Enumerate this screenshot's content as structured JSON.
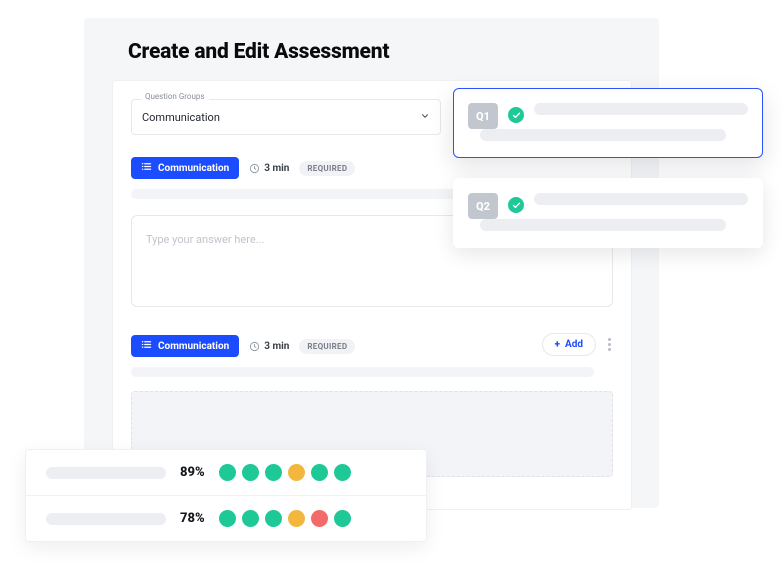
{
  "page": {
    "title": "Create and Edit Assessment"
  },
  "select": {
    "legend": "Question Groups",
    "value": "Communication"
  },
  "group1": {
    "chip": "Communication",
    "duration": "3 min",
    "required": "REQUIRED"
  },
  "textarea": {
    "placeholder": "Type your answer here..."
  },
  "group2": {
    "chip": "Communication",
    "duration": "3 min",
    "required": "REQUIRED",
    "add": "Add"
  },
  "qcards": [
    {
      "id": "Q1"
    },
    {
      "id": "Q2"
    }
  ],
  "colors": {
    "teal": "#1ec997",
    "yellow": "#f3b73e",
    "red": "#f26a6a"
  },
  "results": [
    {
      "pct": "89%",
      "dots": [
        "teal",
        "teal",
        "teal",
        "yellow",
        "teal",
        "teal"
      ]
    },
    {
      "pct": "78%",
      "dots": [
        "teal",
        "teal",
        "teal",
        "yellow",
        "red",
        "teal"
      ]
    }
  ]
}
